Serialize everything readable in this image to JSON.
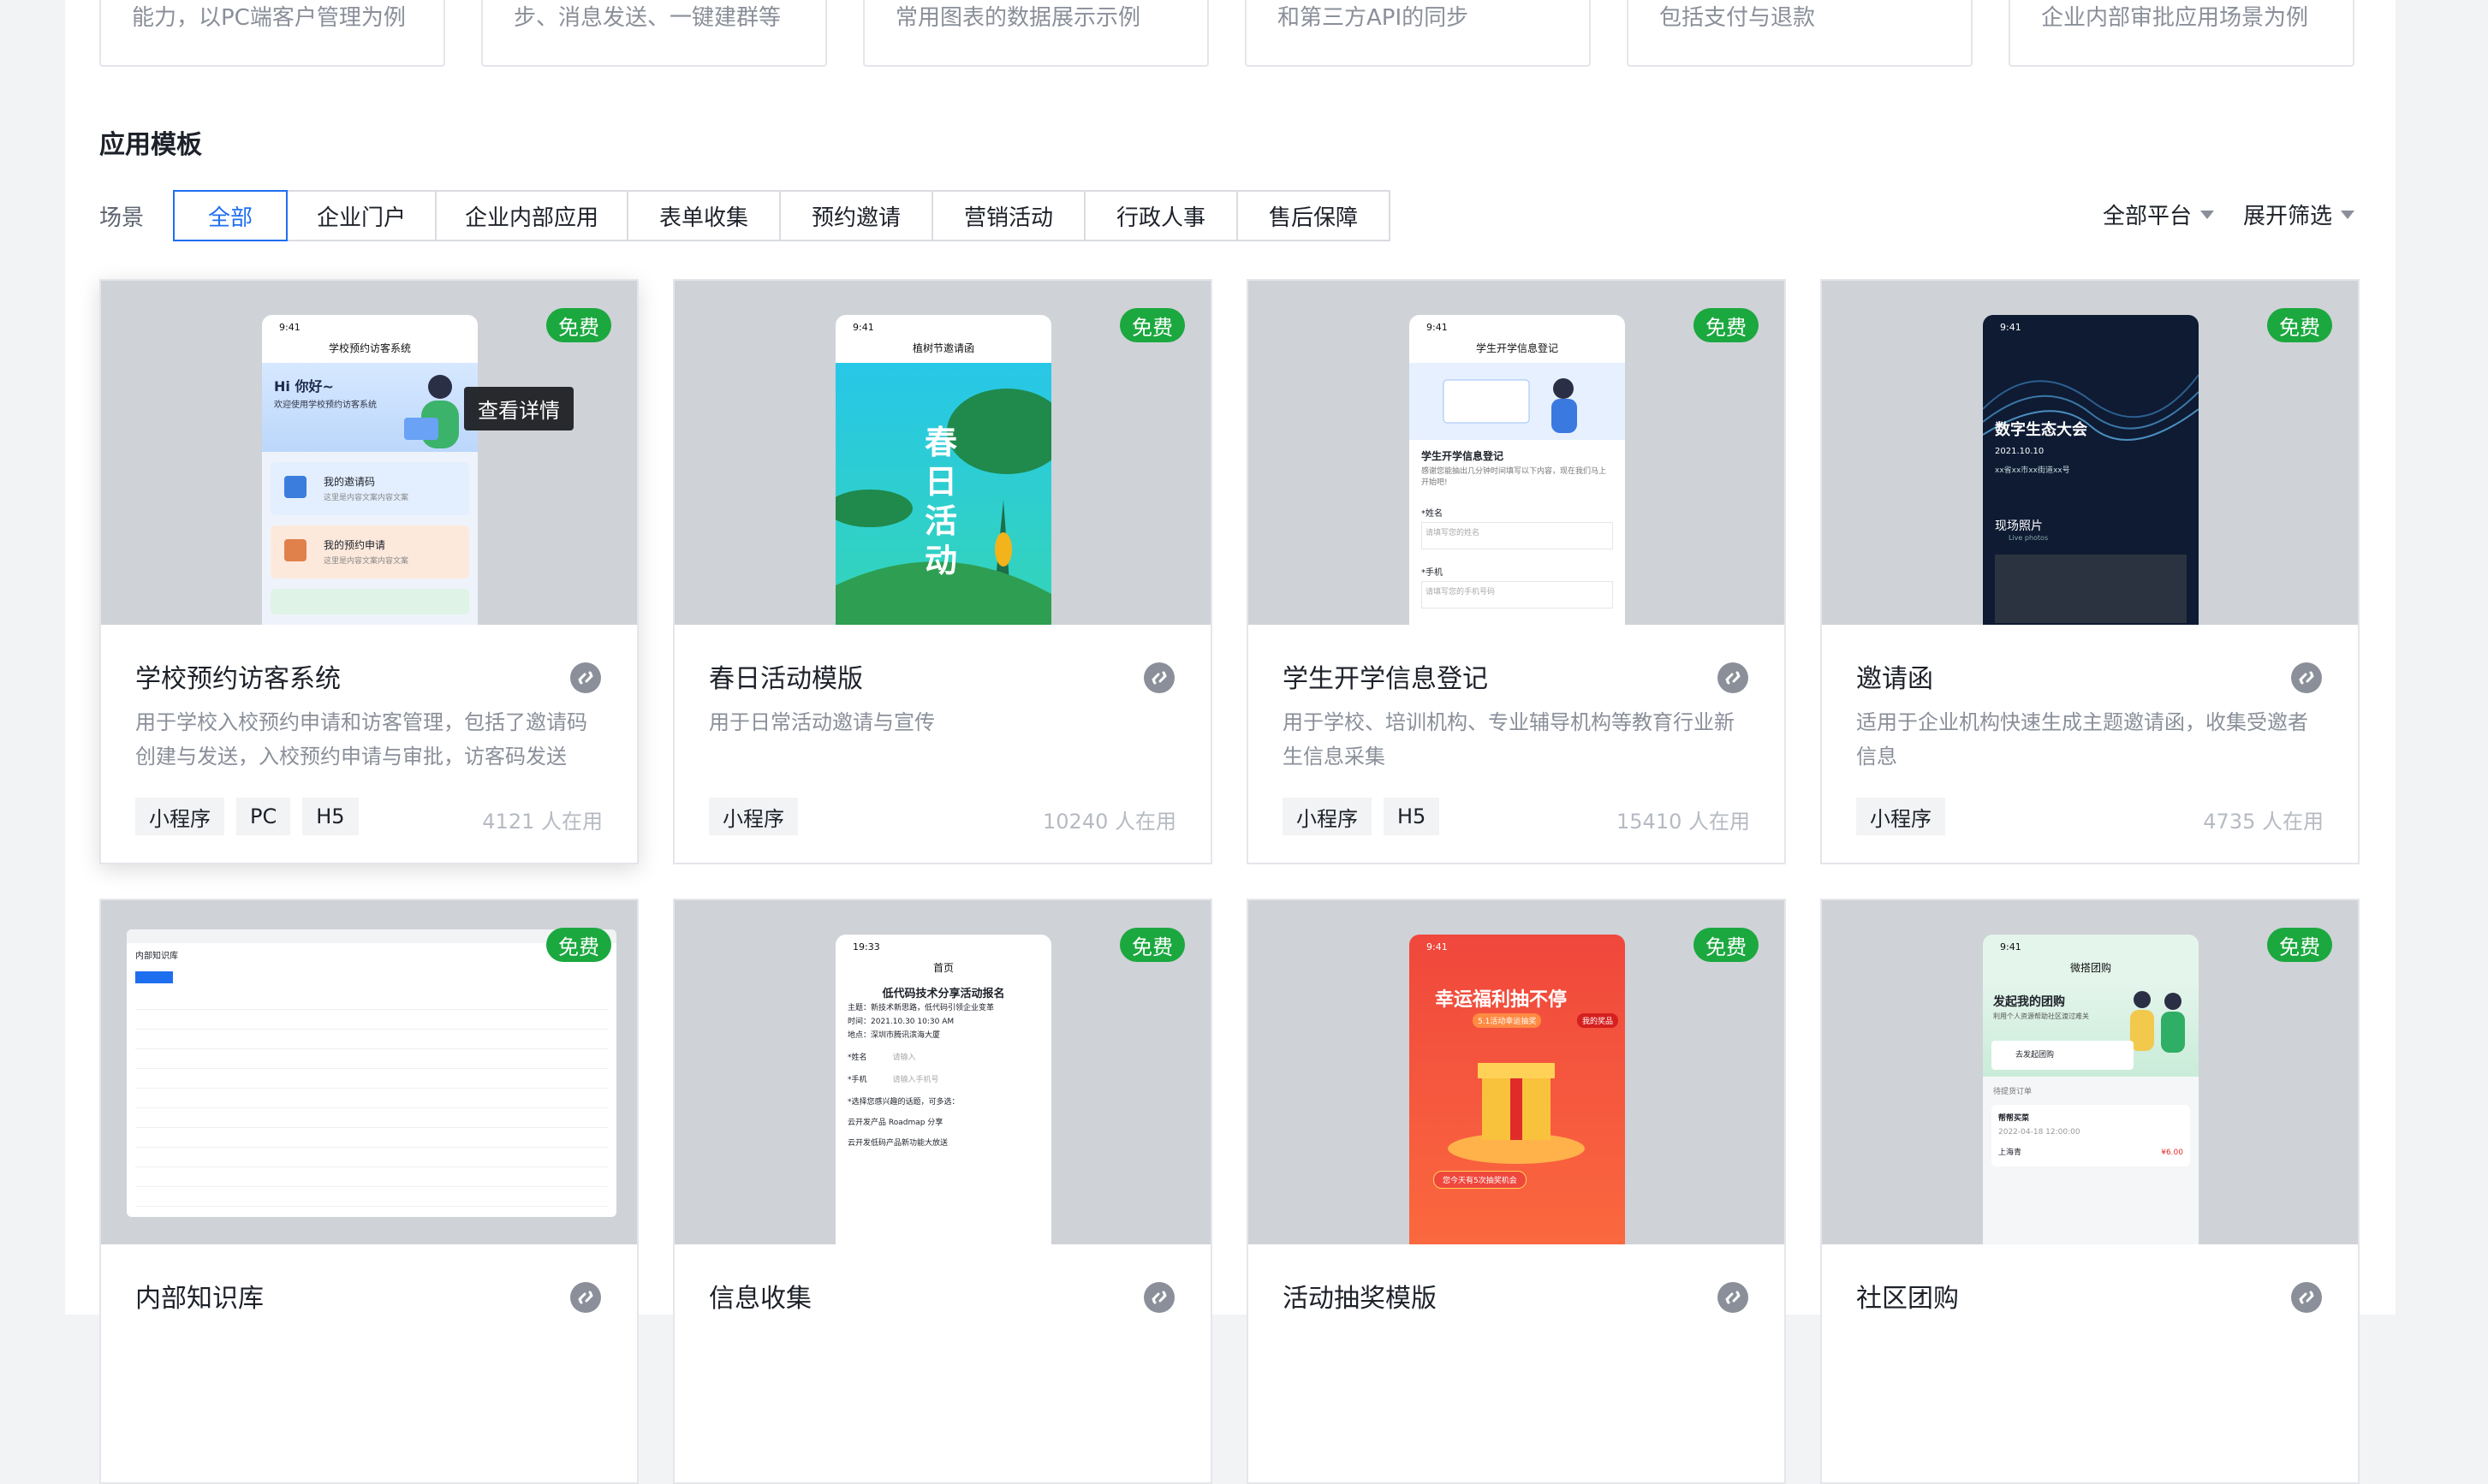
{
  "top_cards": [
    "能力，以PC端客户管理为例",
    "步、消息发送、一键建群等",
    "常用图表的数据展示示例",
    "和第三方API的同步",
    "包括支付与退款",
    "企业内部审批应用场景为例"
  ],
  "section": {
    "title": "应用模板",
    "filter_label": "场景",
    "tabs": [
      "全部",
      "企业门户",
      "企业内部应用",
      "表单收集",
      "预约邀请",
      "营销活动",
      "行政人事",
      "售后保障"
    ],
    "platform_dropdown": "全部平台",
    "expand_filter": "展开筛选"
  },
  "cards": [
    {
      "badge": "免费",
      "title": "学校预约访客系统",
      "desc": "用于学校入校预约申请和访客管理，包括了邀请码创建与发送，入校预约申请与审批，访客码发送和...",
      "tags": [
        "小程序",
        "PC",
        "H5"
      ],
      "usage": "4121 人在用",
      "tooltip": "查看详情",
      "phone": {
        "time": "9:41",
        "nav": "学校预约访客系统",
        "greeting": "Hi 你好~",
        "sub": "欢迎使用学校预约访客系统",
        "item1": "我的邀请码",
        "item1_sub": "这里是内容文案内容文案",
        "item2": "我的预约申请",
        "item2_sub": "这里是内容文案内容文案"
      }
    },
    {
      "badge": "免费",
      "title": "春日活动模版",
      "desc": "用于日常活动邀请与宣传",
      "tags": [
        "小程序"
      ],
      "usage": "10240 人在用",
      "phone": {
        "time": "9:41",
        "nav": "植树节邀请函",
        "poster": "春日活动"
      }
    },
    {
      "badge": "免费",
      "title": "学生开学信息登记",
      "desc": "用于学校、培训机构、专业辅导机构等教育行业新生信息采集",
      "tags": [
        "小程序",
        "H5"
      ],
      "usage": "15410 人在用",
      "phone": {
        "time": "9:41",
        "nav": "学生开学信息登记",
        "form_title": "学生开学信息登记",
        "form_sub": "感谢您能抽出几分钟时间填写以下内容，现在我们马上开始吧!",
        "field1": "*姓名",
        "field1_ph": "请填写您的姓名",
        "field2": "*手机",
        "field2_ph": "请填写您的手机号码"
      }
    },
    {
      "badge": "免费",
      "title": "邀请函",
      "desc": "适用于企业机构快速生成主题邀请函，收集受邀者信息",
      "tags": [
        "小程序"
      ],
      "usage": "4735 人在用",
      "phone": {
        "time": "9:41",
        "headline": "数字生态大会",
        "date": "2021.10.10",
        "addr": "xx省xx市xx街道xx号",
        "photos": "现场照片",
        "photos_en": "Live photos"
      }
    },
    {
      "badge": "免费",
      "title": "内部知识库",
      "phone": {
        "nav": "内部知识库"
      }
    },
    {
      "badge": "免费",
      "title": "信息收集",
      "phone": {
        "time": "19:33",
        "nav": "首页",
        "heading": "低代码技术分享活动报名",
        "l1": "主题：新技术新思路，低代码引领企业变革",
        "l2": "时间：2021.10.30 10:30 AM",
        "l3": "地点：深圳市腾讯滨海大厦",
        "f1": "*姓名",
        "f1_ph": "请输入",
        "f2": "*手机",
        "f2_ph": "请输入手机号",
        "q": "*选择您感兴趣的话题，可多选：",
        "o1": "云开发产品 Roadmap 分享",
        "o2": "云开发低码产品新功能大放送"
      }
    },
    {
      "badge": "免费",
      "title": "活动抽奖模版",
      "phone": {
        "time": "9:41",
        "headline": "幸运福利抽不停",
        "sub": "5.1活动幸运抽奖",
        "prize": "我的奖品",
        "cta": "您今天有5次抽奖机会"
      }
    },
    {
      "badge": "免费",
      "title": "社区团购",
      "phone": {
        "time": "9:41",
        "nav": "微搭团购",
        "headline": "发起我的团购",
        "sub": "利用个人资源帮助社区渡过难关",
        "btn": "去发起团购",
        "orders": "待提货订单",
        "buy": "帮帮买菜",
        "date": "2022-04-18 12:00:00",
        "shop": "上海青",
        "price": "¥6.00"
      }
    }
  ],
  "colors": {
    "accent": "#1e6ff0",
    "badge": "#1ba83f",
    "preview_bg": "#cfd2d7"
  }
}
